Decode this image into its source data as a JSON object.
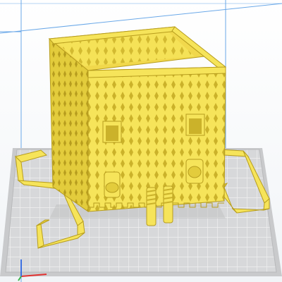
{
  "app": {
    "view": "3d-slicer-viewport",
    "theme_colors": {
      "background": "#ffffff",
      "build_volume_line": "#6aa8e8",
      "plate_surface": "#d7d8da",
      "plate_grid": "#f0f0f0",
      "plate_border": "#b8b9bb",
      "model_fill": "#f6e45a",
      "model_shade": "#e3cc3c",
      "model_dark": "#cbb22a",
      "model_outline": "#b79d1e",
      "axis_x": "#e23232",
      "axis_y": "#3ab44a",
      "axis_z": "#3a6fe0"
    }
  },
  "scene": {
    "objects": [
      {
        "name": "cube-container",
        "shape": "perforated cube with diamond-pattern walls"
      },
      {
        "name": "left-handle",
        "shape": "bracket"
      },
      {
        "name": "right-handle",
        "shape": "bracket"
      },
      {
        "name": "screw-pegs",
        "shape": "two threaded pegs"
      }
    ]
  }
}
